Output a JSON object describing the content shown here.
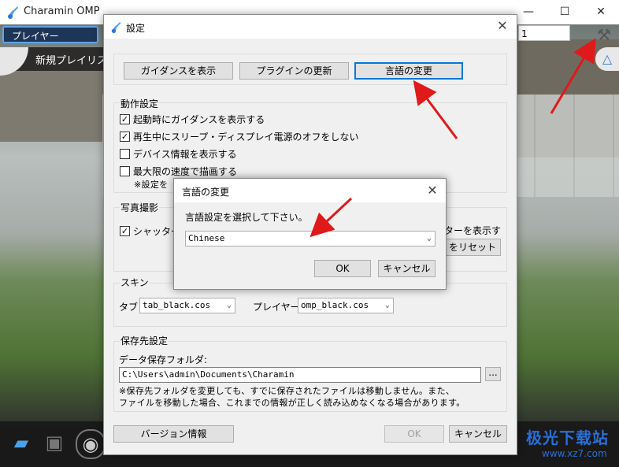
{
  "app": {
    "title": "Charamin OMP",
    "player_tab": "プレイヤー",
    "new_playlist": "新規プレイリスト",
    "input_value": "1",
    "window_controls": [
      "minimize-icon",
      "maximize-icon",
      "close-icon"
    ]
  },
  "settings": {
    "title": "設定",
    "top_buttons": {
      "show_guidance": "ガイダンスを表示",
      "update_plugins": "プラグインの更新",
      "change_language": "言語の変更"
    },
    "behavior": {
      "label": "動作設定",
      "items": [
        {
          "label": "起動時にガイダンスを表示する",
          "checked": true
        },
        {
          "label": "再生中にスリープ・ディスプレイ電源のオフをしない",
          "checked": true
        },
        {
          "label": "デバイス情報を表示する",
          "checked": false
        },
        {
          "label": "最大限の速度で描画する",
          "checked": false
        }
      ],
      "note": "※設定を"
    },
    "photo": {
      "label": "写真撮影",
      "shutter_label": "シャッター",
      "shutter_checked": true,
      "right_text": "ターを表示す",
      "reset_button": "をリセット"
    },
    "skin": {
      "label": "スキン",
      "tab_label": "タブ",
      "tab_value": "tab_black.cos",
      "player_label": "プレイヤー",
      "player_value": "omp_black.cos"
    },
    "save": {
      "label": "保存先設定",
      "folder_label": "データ保存フォルダ:",
      "folder_path": "C:\\Users\\admin\\Documents\\Charamin",
      "browse": "...",
      "note_line1": "※保存先フォルダを変更しても、すでに保存されたファイルは移動しません。また、",
      "note_line2": "ファイルを移動した場合、これまでの情報が正しく読み込めなくなる場合があります。"
    },
    "footer": {
      "version_button": "バージョン情報",
      "ok_button": "OK",
      "cancel_button": "キャンセル"
    }
  },
  "language_dialog": {
    "title": "言語の変更",
    "prompt": "言語設定を選択して下さい。",
    "selected": "Chinese",
    "ok": "OK",
    "cancel": "キャンセル"
  },
  "watermark": {
    "text": "极光下载站",
    "url": "www.xz7.com"
  },
  "colors": {
    "accent": "#0078d7",
    "arrow": "#e0191b",
    "watermark": "#2b6fd6"
  }
}
